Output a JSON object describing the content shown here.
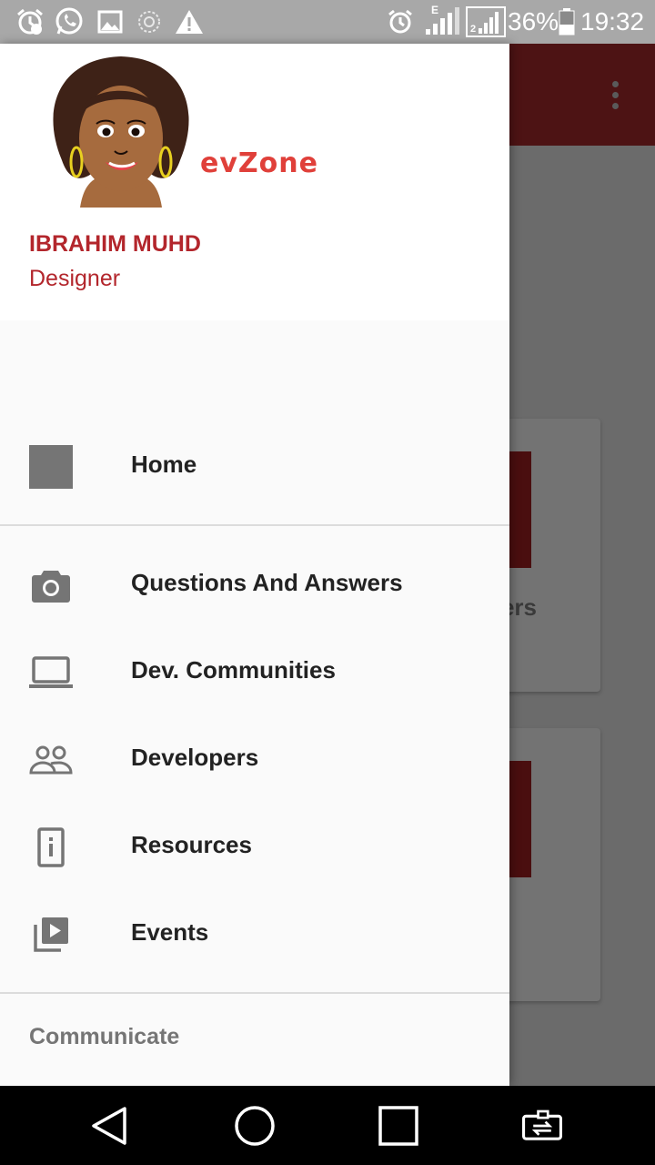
{
  "status_bar": {
    "battery_percent": "36%",
    "time": "19:32",
    "network_type": "E",
    "sim_slot": "2",
    "icons_left": [
      "alarm-icon",
      "whatsapp-icon",
      "gallery-icon",
      "sync-icon",
      "warning-icon"
    ],
    "icons_right": [
      "alarm-icon",
      "signal-sim1-icon",
      "signal-sim2-icon",
      "battery-icon"
    ]
  },
  "drawer": {
    "header": {
      "brand_text": "evZone",
      "user_name": "IBRAHIM MUHD",
      "user_role": "Designer"
    },
    "items": [
      {
        "label": "Home",
        "icon": "home-placeholder-icon"
      },
      {
        "label": "Questions And Answers",
        "icon": "camera-icon"
      },
      {
        "label": "Dev. Communities",
        "icon": "laptop-icon"
      },
      {
        "label": "Developers",
        "icon": "people-icon"
      },
      {
        "label": "Resources",
        "icon": "info-icon"
      },
      {
        "label": "Events",
        "icon": "video-library-icon"
      }
    ],
    "section_header": "Communicate"
  },
  "background": {
    "card_label_fragment": "ers"
  },
  "colors": {
    "status_bar": "#a8a8a8",
    "app_bar": "#4d1314",
    "accent_red": "#b3262c",
    "brand_red": "#e0403a",
    "drawer_bg": "#fafafa",
    "scrim": "#6b6b6b"
  },
  "navbar": {
    "buttons": [
      "back-icon",
      "home-circle-icon",
      "recents-icon",
      "switch-app-icon"
    ]
  }
}
